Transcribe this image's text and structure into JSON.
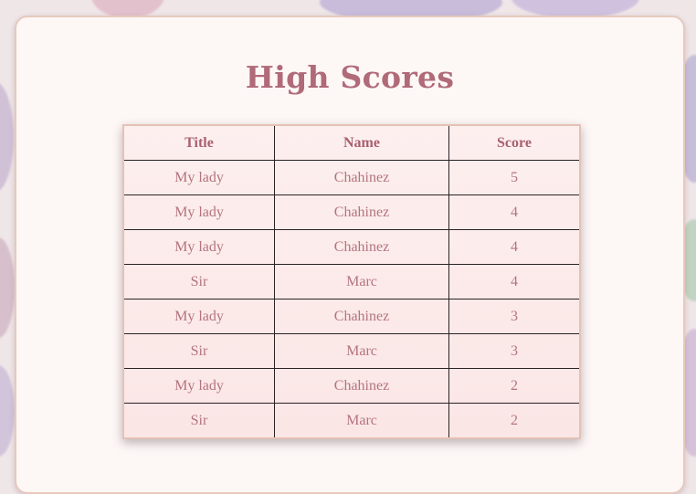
{
  "page": {
    "heading": "High Scores"
  },
  "table": {
    "headers": [
      "Title",
      "Name",
      "Score"
    ],
    "rows": [
      [
        "My lady",
        "Chahinez",
        "5"
      ],
      [
        "My lady",
        "Chahinez",
        "4"
      ],
      [
        "My lady",
        "Chahinez",
        "4"
      ],
      [
        "Sir",
        "Marc",
        "4"
      ],
      [
        "My lady",
        "Chahinez",
        "3"
      ],
      [
        "Sir",
        "Marc",
        "3"
      ],
      [
        "My lady",
        "Chahinez",
        "2"
      ],
      [
        "Sir",
        "Marc",
        "2"
      ]
    ]
  },
  "colors": {
    "accent": "#b06a78",
    "card_background": "#fdf7f6",
    "card_border": "#e7c9bd",
    "table_text": "#b4747f",
    "grid_line": "#2b2224"
  }
}
